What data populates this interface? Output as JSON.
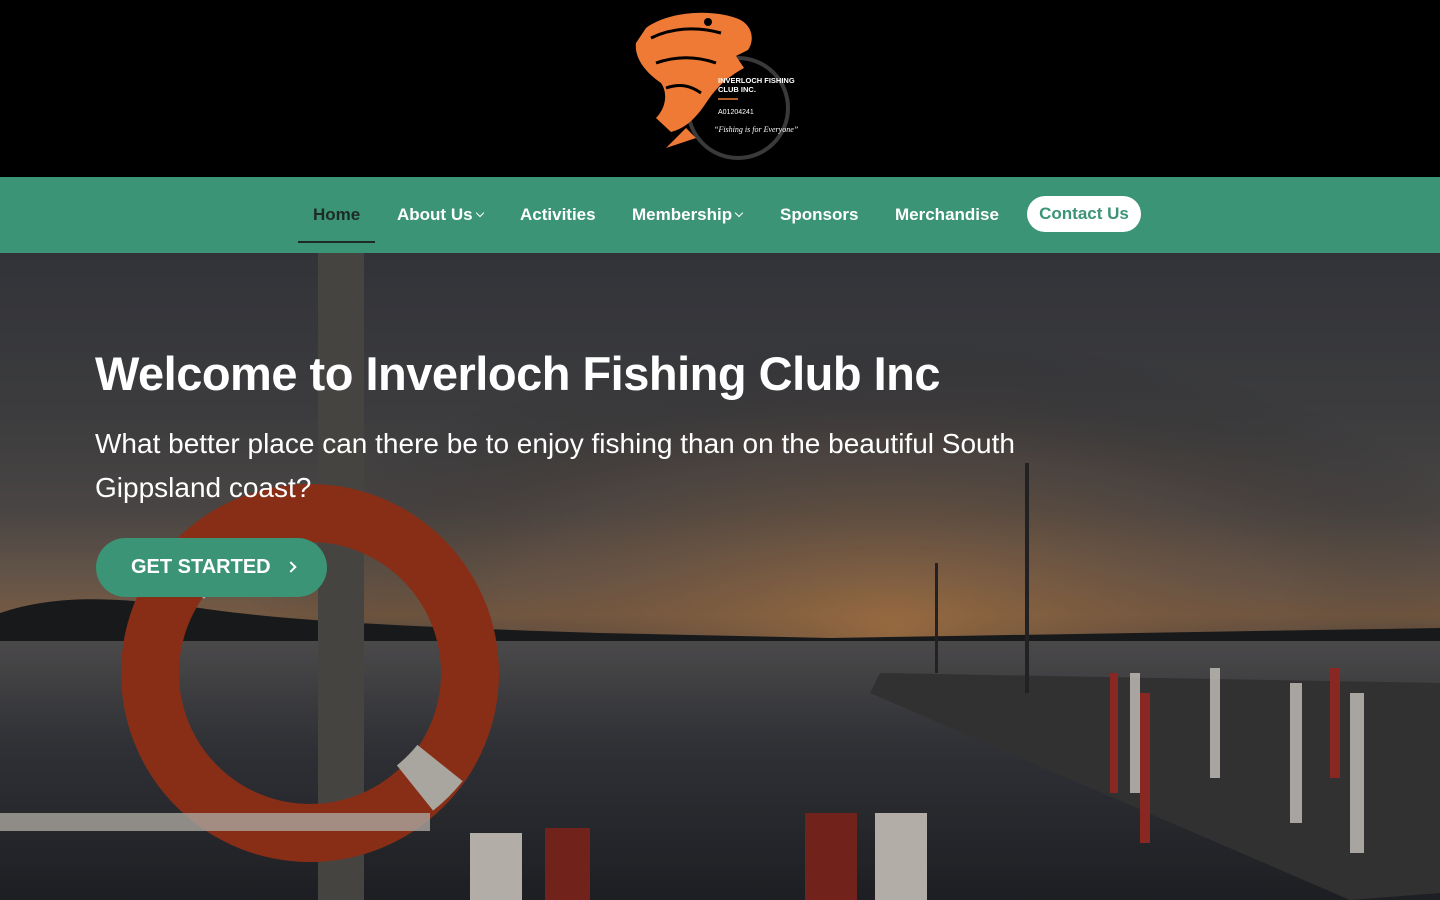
{
  "brand": {
    "name_line1": "INVERLOCH FISHING",
    "name_line2": "CLUB INC.",
    "reg_number": "A01204241",
    "tagline": "“Fishing is for Everyone”",
    "accent_color": "#ef7a35"
  },
  "nav": {
    "items": [
      {
        "label": "Home",
        "active": true
      },
      {
        "label": "About Us",
        "dropdown": true
      },
      {
        "label": "Activities"
      },
      {
        "label": "Membership",
        "dropdown": true
      },
      {
        "label": "Sponsors"
      },
      {
        "label": "Merchandise"
      }
    ],
    "contact_label": "Contact Us",
    "bar_color": "#3b9475"
  },
  "hero": {
    "title": "Welcome to Inverloch Fishing Club Inc",
    "subtitle": "What better place can there be to enjoy fishing than on the beautiful South Gippsland coast?",
    "cta_label": "GET STARTED"
  }
}
